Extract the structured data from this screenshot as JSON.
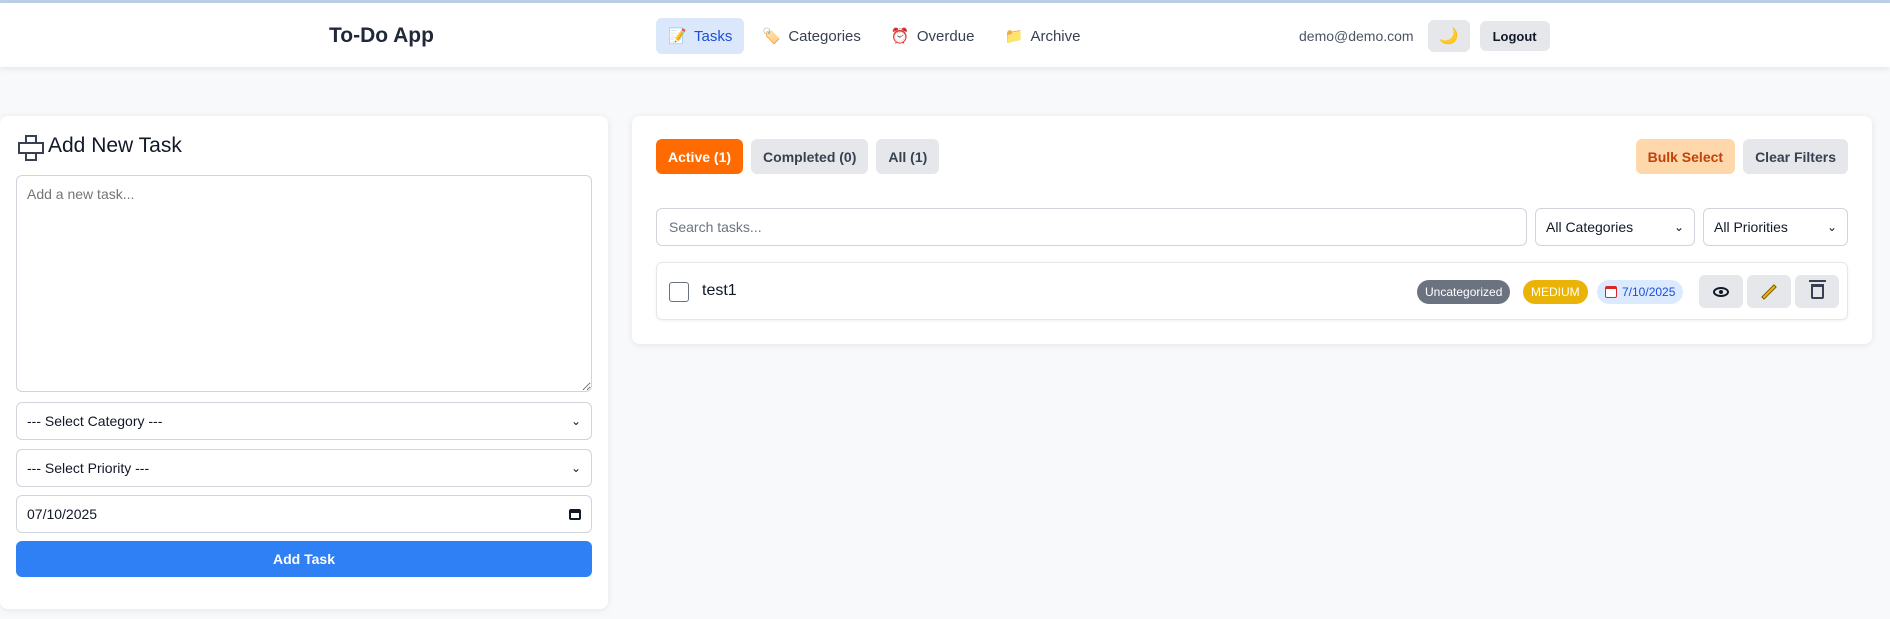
{
  "app": {
    "title": "To-Do App"
  },
  "nav": [
    {
      "label": "Tasks",
      "icon": "📝",
      "active": true
    },
    {
      "label": "Categories",
      "icon": "🏷️",
      "active": false
    },
    {
      "label": "Overdue",
      "icon": "⏰",
      "active": false
    },
    {
      "label": "Archive",
      "icon": "📁",
      "active": false
    }
  ],
  "user": {
    "email": "demo@demo.com",
    "theme_icon": "🌙",
    "logout_label": "Logout"
  },
  "add_task": {
    "title": "Add New Task",
    "textarea_placeholder": "Add a new task...",
    "category_placeholder": "--- Select Category ---",
    "priority_placeholder": "--- Select Priority ---",
    "date_value": "07/10/2025",
    "button_label": "Add Task"
  },
  "task_list": {
    "tabs": [
      {
        "label": "Active (1)",
        "active": true
      },
      {
        "label": "Completed (0)",
        "active": false
      },
      {
        "label": "All (1)",
        "active": false
      }
    ],
    "bulk_select_label": "Bulk Select",
    "clear_filters_label": "Clear Filters",
    "search_placeholder": "Search tasks...",
    "category_filter": "All Categories",
    "priority_filter": "All Priorities",
    "tasks": [
      {
        "title": "test1",
        "category": "Uncategorized",
        "priority": "MEDIUM",
        "date": "7/10/2025"
      }
    ]
  },
  "colors": {
    "accent": "#2f80f5",
    "active_tab": "#ff6b00",
    "medium_priority": "#eab308",
    "uncategorized": "#6b7280"
  }
}
